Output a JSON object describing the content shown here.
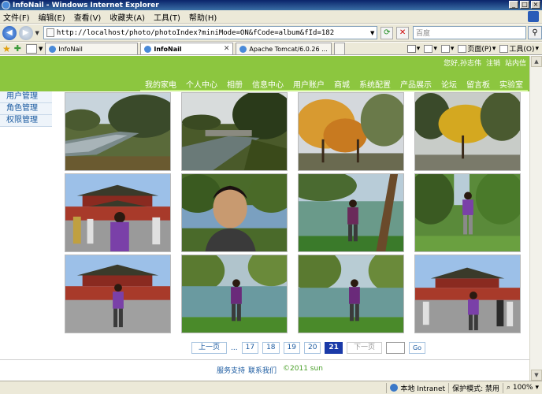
{
  "window": {
    "title": "InfoNail - Windows Internet Explorer"
  },
  "menubar": [
    "文件(F)",
    "编辑(E)",
    "查看(V)",
    "收藏夹(A)",
    "工具(T)",
    "帮助(H)"
  ],
  "address": {
    "url": "http://localhost/photo/photoIndex?miniMode=ON&fCode=album&fId=182",
    "search_placeholder": "百度"
  },
  "tabs": [
    {
      "label": "InfoNail",
      "active": false
    },
    {
      "label": "InfoNail",
      "active": true
    },
    {
      "label": "Apache Tomcat/6.0.26 ...",
      "active": false
    }
  ],
  "toolbar": {
    "page": "页面(P)",
    "tools": "工具(O)"
  },
  "site": {
    "greeting": "您好,孙志伟",
    "logout": "注销",
    "inbox": "站内信",
    "nav": [
      "我的家电",
      "个人中心",
      "相册",
      "信息中心",
      "用户账户",
      "商城",
      "系统配置",
      "产品展示",
      "论坛",
      "留言板",
      "实验室"
    ],
    "sidebar": [
      "用户管理",
      "角色管理",
      "权限管理"
    ]
  },
  "pager": {
    "prev": "上一页",
    "ellipsis": "...",
    "pages": [
      "17",
      "18",
      "19",
      "20",
      "21"
    ],
    "current": "21",
    "next": "下一页",
    "go": "Go"
  },
  "footer": {
    "support": "服务支持",
    "contact": "联系我们",
    "copyright": "©2011 sun"
  },
  "statusbar": {
    "zone": "本地 Intranet",
    "protected": "保护模式: 禁用",
    "zoom": "100%"
  },
  "photos": [
    {
      "name": "canal-trees"
    },
    {
      "name": "canal-bridge"
    },
    {
      "name": "autumn-trees"
    },
    {
      "name": "yellow-tree"
    },
    {
      "name": "tiananmen-crowd"
    },
    {
      "name": "portrait-lake"
    },
    {
      "name": "man-lake-tree"
    },
    {
      "name": "man-park"
    },
    {
      "name": "tiananmen-man"
    },
    {
      "name": "man-willow-lake"
    },
    {
      "name": "man-lake-walk"
    },
    {
      "name": "tiananmen-group"
    }
  ]
}
